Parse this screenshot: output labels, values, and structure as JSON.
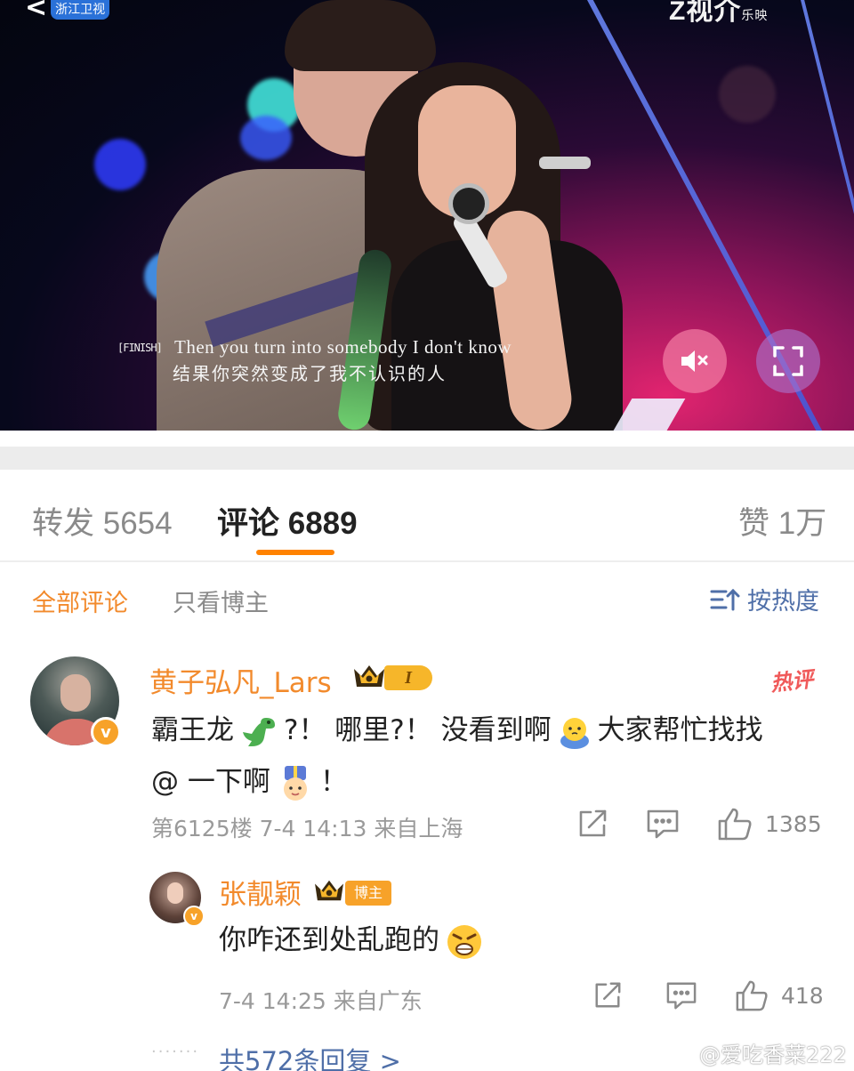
{
  "video": {
    "station_logo_text": "浙江卫视",
    "corner_logo_text": "Z视介",
    "corner_logo_sub": "乐映",
    "subtitle_mark": "[FINISH]",
    "subtitle_en": "Then you turn into somebody I don't know",
    "subtitle_cn": "结果你突然变成了我不认识的人",
    "icons": [
      "mute-icon",
      "fullscreen-icon"
    ]
  },
  "tabs": [
    {
      "label": "转发 5654"
    },
    {
      "label": "评论 6889",
      "active": true
    },
    {
      "label": "赞 1万"
    }
  ],
  "filters": {
    "all": "全部评论",
    "owner_only": "只看博主",
    "sort": "按热度"
  },
  "comment": {
    "username": "黄子弘凡_Lars",
    "level": "I",
    "hot_tag": "热评",
    "text_1": "霸王龙",
    "text_2": "?！ 哪里?！ 没看到啊",
    "text_3": "大家帮忙找找",
    "text_4": "@ 一下啊",
    "text_5": "！",
    "floor": "第6125楼",
    "time": "7-4 14:13",
    "location": "来自上海",
    "likes": "1385"
  },
  "reply": {
    "username": "张靓颖",
    "badge": "博主",
    "text": "你咋还到处乱跑的",
    "time": "7-4 14:25",
    "location": "来自广东",
    "likes": "418"
  },
  "more_replies": "共572条回复 >",
  "watermark": "@爱吃香菜222",
  "colors": {
    "accent_orange": "#ff8200",
    "username_orange": "#f28a2c",
    "link_blue": "#4f6fa8",
    "hot_red": "#f05a5a",
    "badge_gold": "#f7a229"
  }
}
